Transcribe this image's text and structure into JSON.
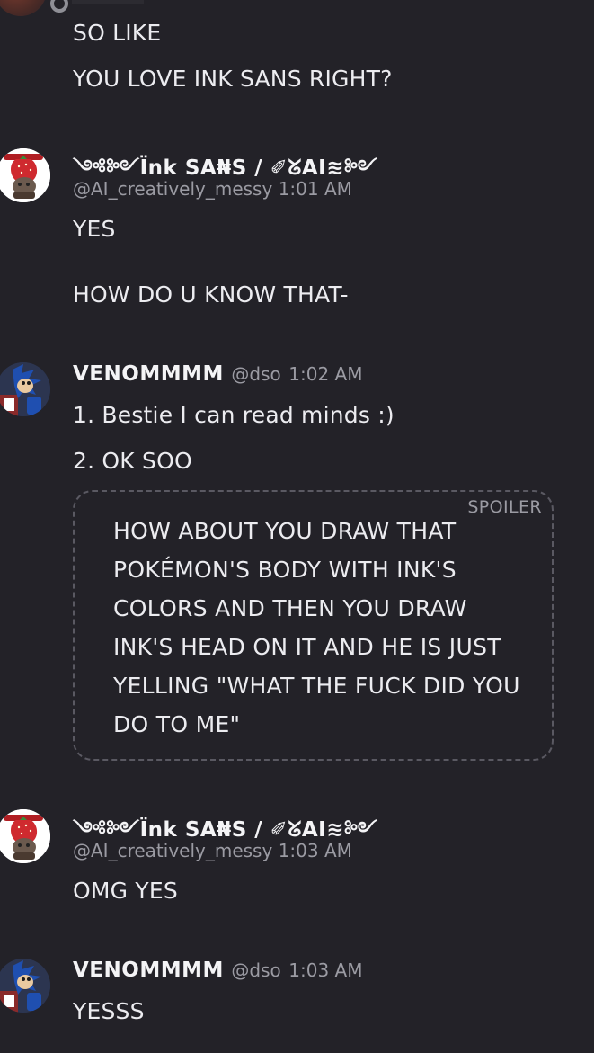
{
  "messages": {
    "first": {
      "line1": "SO LIKE",
      "line2": "YOU LOVE INK SANS RIGHT?"
    },
    "m1": {
      "username": "༺༻Ïnk SA₦S / ✐ᘜAI≋༻",
      "handle": "@AI_creatively_messy",
      "time": "1:01 AM",
      "line1": "YES",
      "line2": "HOW DO U KNOW THAT-"
    },
    "m2": {
      "username": "VENOMMMM",
      "handle": "@dso",
      "time": "1:02 AM",
      "line1": "1. Bestie I can read minds :)",
      "line2": "2. OK SOO",
      "spoiler_tag": "SPOILER",
      "spoiler_text": "HOW ABOUT YOU DRAW THAT POKÉMON'S BODY WITH INK'S COLORS AND THEN YOU DRAW INK'S HEAD ON IT AND HE IS JUST YELLING \"WHAT THE FUCK DID YOU DO TO ME\""
    },
    "m3": {
      "username": "༺༻Ïnk SA₦S / ✐ᘜAI≋༻",
      "handle": "@AI_creatively_messy",
      "time": "1:03 AM",
      "line1": "OMG YES"
    },
    "m4": {
      "username": "VENOMMMM",
      "handle": "@dso",
      "time": "1:03 AM",
      "line1": "YESSS"
    }
  },
  "icons": {
    "avatar_ink": "strawberry-cat-avatar-icon",
    "avatar_venom": "sonic-avatar-icon"
  }
}
